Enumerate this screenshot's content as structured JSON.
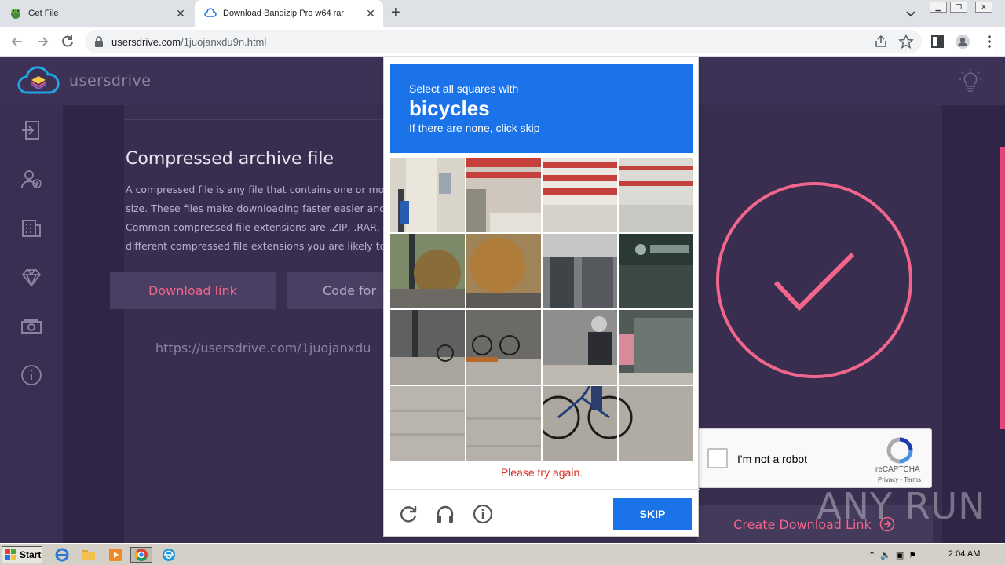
{
  "browser": {
    "tabs": [
      {
        "title": "Get File"
      },
      {
        "title": "Download Bandizip Pro w64 rar"
      }
    ],
    "url_host": "usersdrive.com",
    "url_path": "/1juojanxdu9n.html"
  },
  "site": {
    "brand": "usersdrive",
    "sidebar_icons": [
      "sign-in-icon",
      "add-user-icon",
      "building-icon",
      "diamond-icon",
      "money-icon",
      "info-icon"
    ],
    "article_title": "Compressed archive file",
    "article_lines": [
      "A compressed file is any file that contains one or more",
      "size. These files make downloading faster easier and al",
      "Common compressed file extensions are .ZIP, .RAR, .AR",
      "different compressed file extensions you are likely to"
    ],
    "tab_download": "Download link",
    "tab_code": "Code for",
    "link_value": "https://usersdrive.com/1juojanxdu",
    "create_button": "Create Download Link",
    "accent": "#f2668b"
  },
  "recaptcha": {
    "checkbox_label": "I'm not a robot",
    "brand": "reCAPTCHA",
    "terms": "Privacy - Terms"
  },
  "challenge": {
    "line1": "Select all squares with",
    "object": "bicycles",
    "line3": "If there are none, click skip",
    "error": "Please try again.",
    "skip": "SKIP",
    "header_color": "#1a73e8"
  },
  "watermark": "ANY RUN",
  "taskbar": {
    "start": "Start",
    "clock": "2:04 AM"
  }
}
